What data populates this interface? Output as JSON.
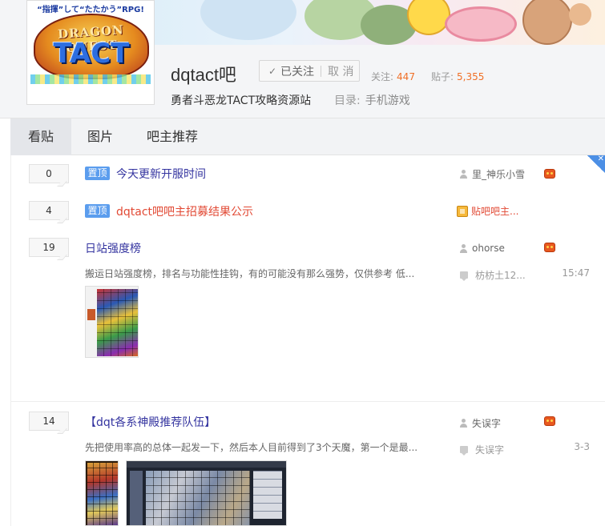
{
  "header": {
    "logo": {
      "tagline": "“指揮”して“たたかう”RPG!",
      "wordmark_top": "DRAGON QUEST",
      "wordmark_main": "TACT"
    },
    "forum_name": "dqtact吧",
    "follow_button": {
      "followed_label": "已关注",
      "unfollow_label": "取 消"
    },
    "stats": {
      "followers_label": "关注:",
      "followers": "447",
      "posts_label": "贴子:",
      "posts": "5,355"
    },
    "slogan": "勇者斗恶龙TACT攻略资源站",
    "directory": {
      "label": "目录:",
      "value": "手机游戏"
    }
  },
  "tabs": [
    {
      "label": "看贴",
      "active": true
    },
    {
      "label": "图片",
      "active": false
    },
    {
      "label": "吧主推荐",
      "active": false
    }
  ],
  "threads": [
    {
      "reply_count": "0",
      "pinned": true,
      "pin_label": "置顶",
      "title": "今天更新开服时间",
      "author": "里_神乐小雪"
    },
    {
      "reply_count": "4",
      "pinned": true,
      "pin_label": "置顶",
      "title": "dqtact吧吧主招募结果公示",
      "author": "贴吧吧主..."
    },
    {
      "reply_count": "19",
      "pinned": false,
      "title": "日站强度榜",
      "author": "ohorse",
      "abstract": "搬运日站强度榜，排名与功能性挂钩，有的可能没有那么强势，仅供参考 低...",
      "last_reply_user": "枋枋土12...",
      "last_reply_time": "15:47"
    },
    {
      "reply_count": "14",
      "pinned": false,
      "title": "【dqt各系神殿推荐队伍】",
      "author": "失误字",
      "abstract": "先把使用率高的总体一起发一下，然后本人目前得到了3个天魔，第一个是最...",
      "last_reply_user": "失误字",
      "last_reply_time": "3-3"
    }
  ],
  "colors": {
    "accent": "#2d64b3",
    "pin_tag": "#5b9dee",
    "stat_number": "#f06f26",
    "owner_red": "#e24a35"
  }
}
